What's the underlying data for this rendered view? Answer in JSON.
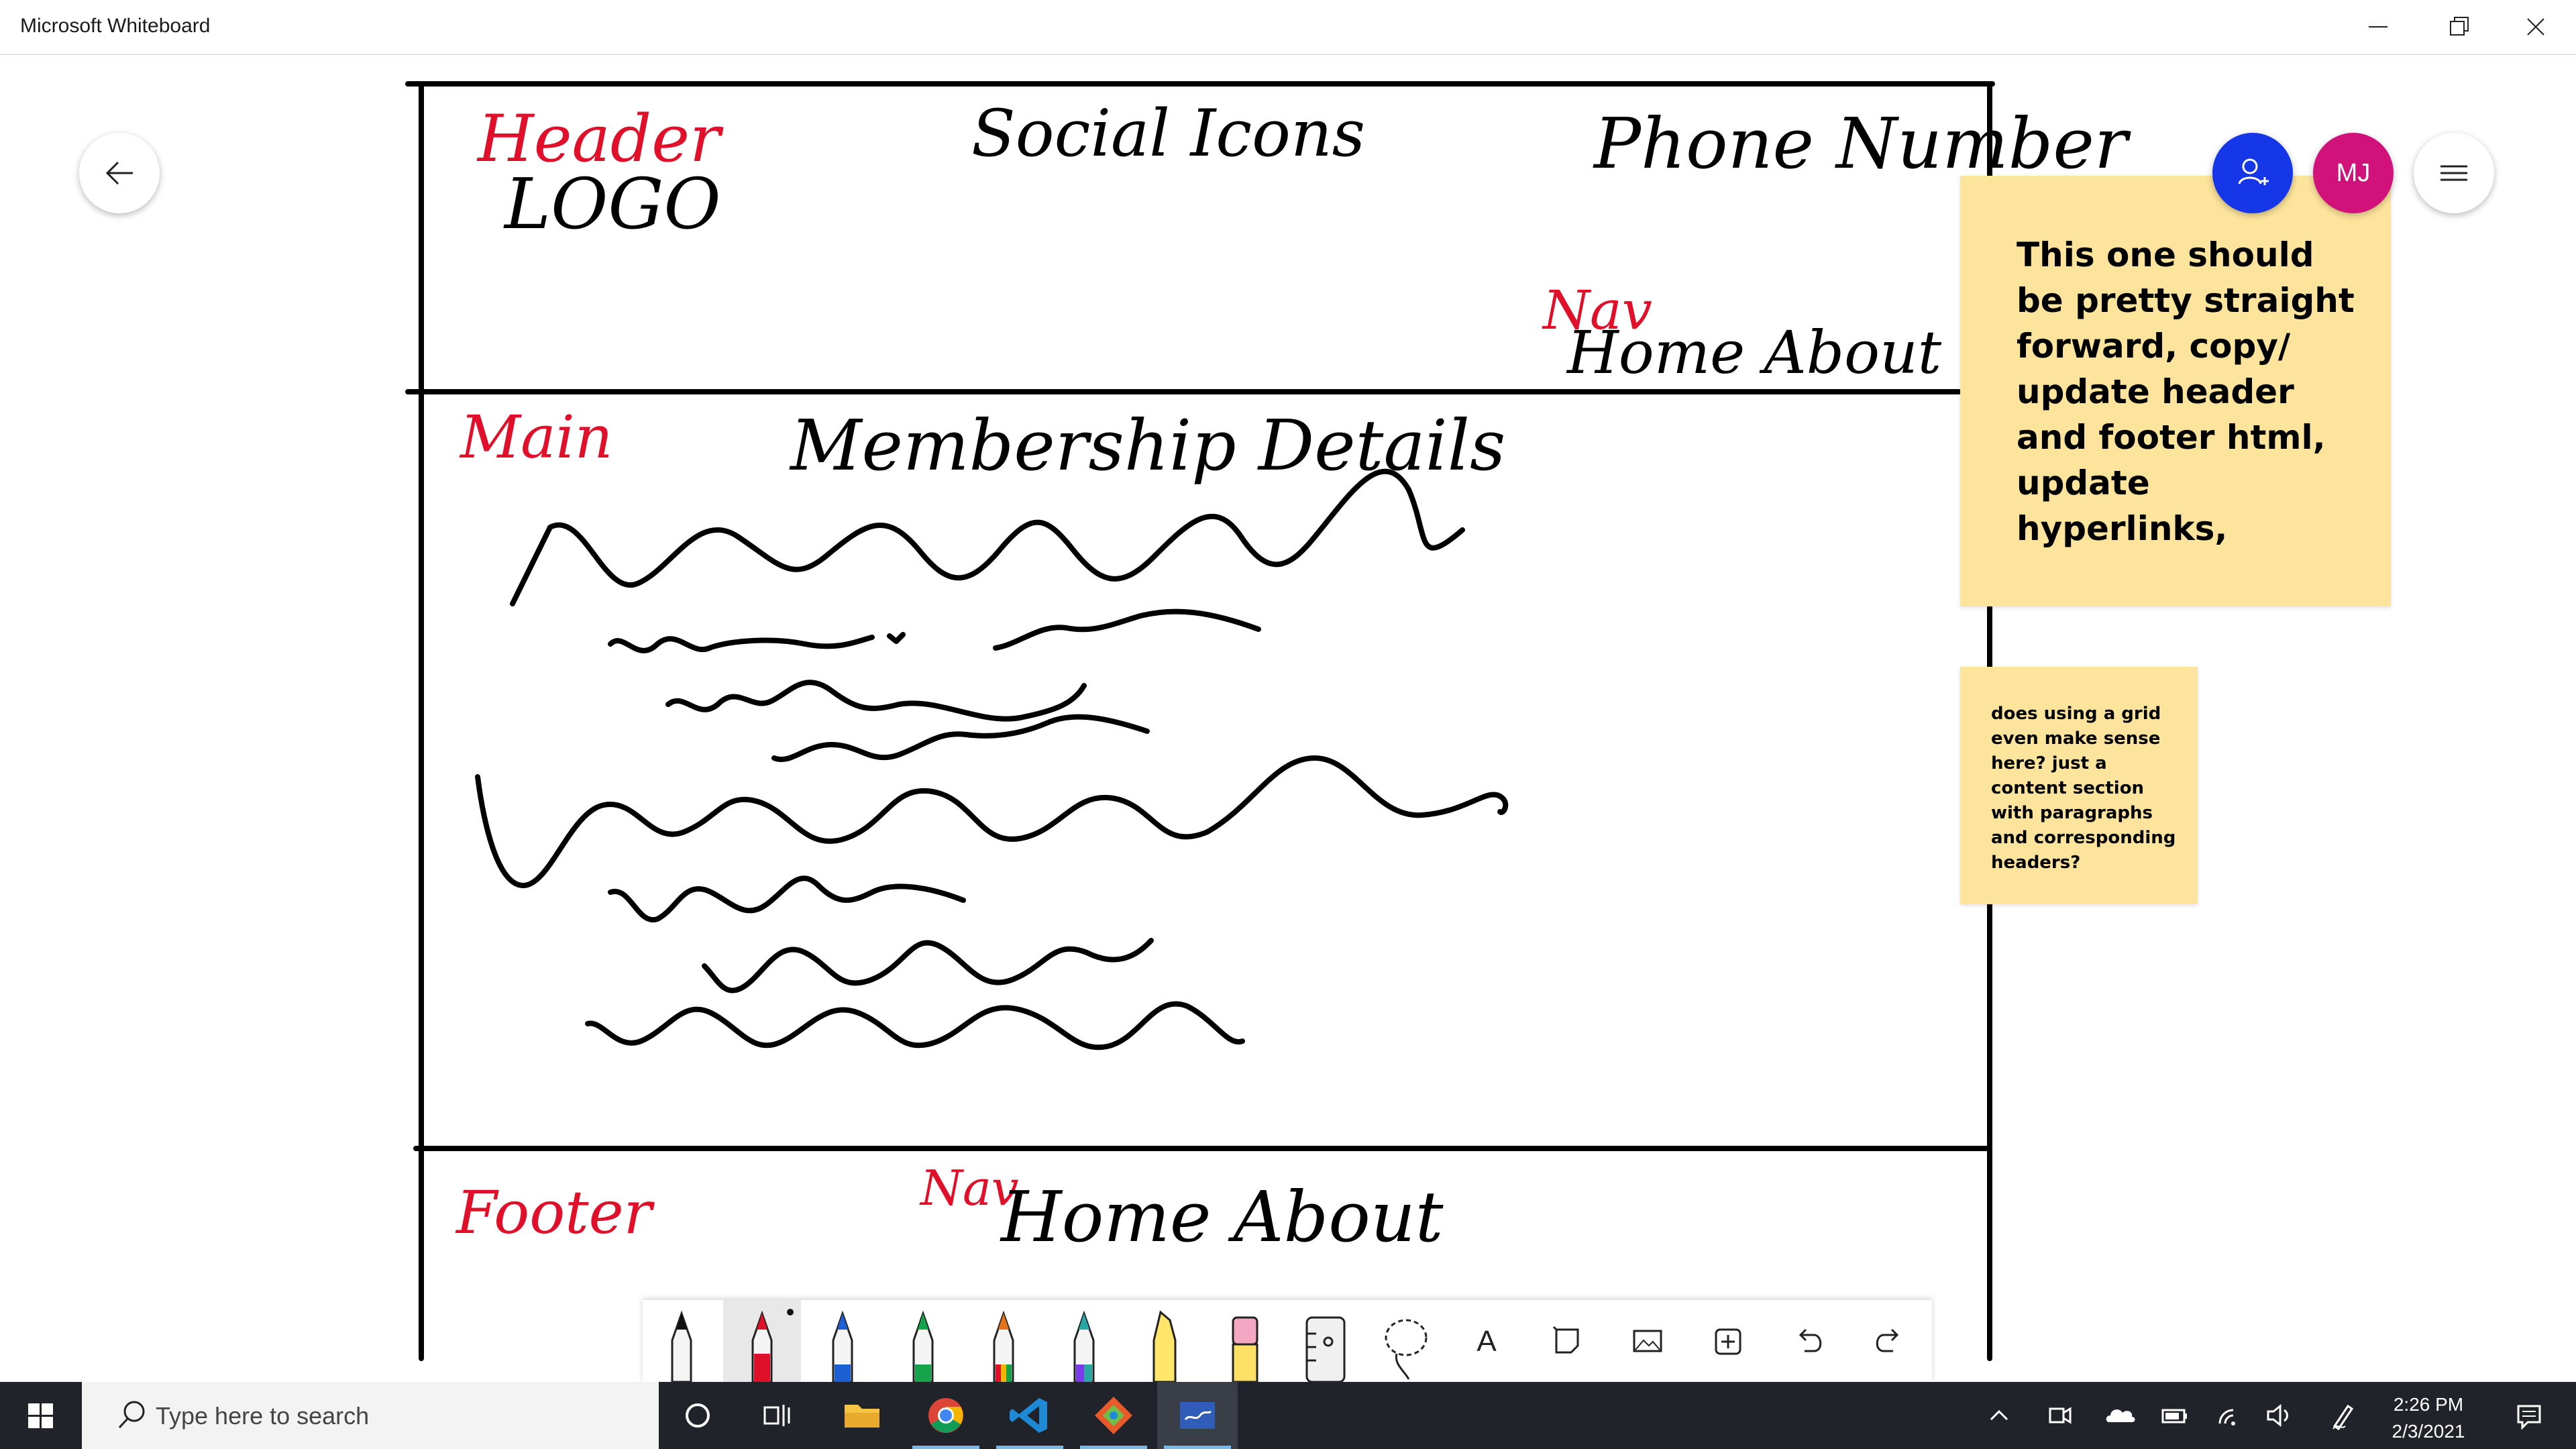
{
  "window": {
    "title": "Microsoft Whiteboard",
    "controls": [
      "minimize-icon",
      "restore-icon",
      "close-icon"
    ]
  },
  "board": {
    "handwriting": {
      "header_label": "Header",
      "logo": "LOGO",
      "social_icons": "Social Icons",
      "phone_number": "Phone Number",
      "nav_label_top": "Nav",
      "nav_links_top": "Home  About Us",
      "main_label": "Main",
      "membership_details": "Membership Details",
      "footer_label": "Footer",
      "nav_label_footer": "Nav",
      "nav_links_footer": "Home  About"
    },
    "sticky_notes": [
      {
        "text": "This one should be pretty straight forward, copy/ update header and footer html, update hyperlinks,"
      },
      {
        "text": "does using a grid even make sense here? just a content section with paragraphs and corresponding headers?"
      }
    ],
    "ink_colors": {
      "black": "#000000",
      "red": "#e0102a"
    }
  },
  "top_controls": {
    "back": "back-arrow-icon",
    "invite": "invite-people-icon",
    "avatar_initials": "MJ",
    "avatar_color": "#d0127a",
    "invite_color": "#1537e8",
    "menu": "hamburger-menu-icon"
  },
  "toolbar": {
    "tools": [
      "black-pen",
      "red-pen",
      "blue-pen",
      "green-pen",
      "rainbow-pen",
      "galaxy-pen",
      "yellow-highlighter",
      "pink-eraser",
      "ruler",
      "lasso",
      "text",
      "sticky-note",
      "image",
      "insert",
      "undo",
      "redo"
    ],
    "selected": "red-pen",
    "text_tool_glyph": "A"
  },
  "taskbar": {
    "search_placeholder": "Type here to search",
    "time": "2:26 PM",
    "date": "2/3/2021",
    "apps": [
      "cortana",
      "task-view",
      "file-explorer",
      "chrome",
      "vscode",
      "git-kraken",
      "whiteboard"
    ]
  }
}
